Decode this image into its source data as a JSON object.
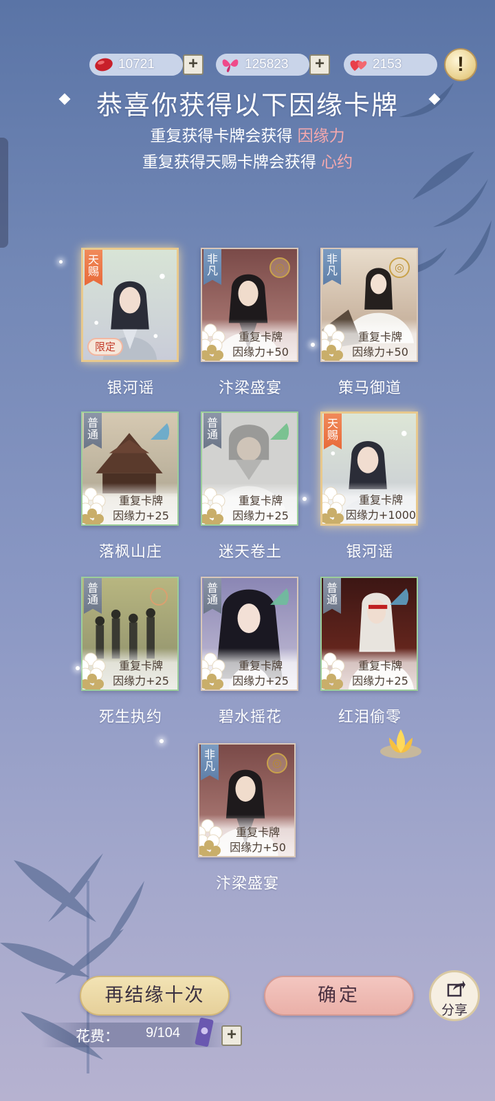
{
  "currency": [
    {
      "icon": "red-bean-icon",
      "value": "10721",
      "has_plus": true
    },
    {
      "icon": "butterfly-icon",
      "value": "125823",
      "has_plus": true
    },
    {
      "icon": "hearts-icon",
      "value": "2153",
      "has_plus": false
    }
  ],
  "alert_label": "!",
  "header": {
    "title": "恭喜你获得以下因缘卡牌",
    "line1_text": "重复获得卡牌会获得",
    "line1_highlight": "因缘力",
    "line2_text": "重复获得天赐卡牌会获得",
    "line2_highlight": "心约"
  },
  "cards": [
    {
      "name": "银河谣",
      "rarity": "天赐",
      "limited": "限定",
      "duplicate": false,
      "dup_line1": "",
      "dup_line2": ""
    },
    {
      "name": "汴梁盛宴",
      "rarity": "非凡",
      "limited": "",
      "duplicate": true,
      "dup_line1": "重复卡牌",
      "dup_line2": "因缘力+50"
    },
    {
      "name": "策马御道",
      "rarity": "非凡",
      "limited": "",
      "duplicate": true,
      "dup_line1": "重复卡牌",
      "dup_line2": "因缘力+50"
    },
    {
      "name": "落枫山庄",
      "rarity": "普通",
      "limited": "",
      "duplicate": true,
      "dup_line1": "重复卡牌",
      "dup_line2": "因缘力+25"
    },
    {
      "name": "迷天卷土",
      "rarity": "普通",
      "limited": "",
      "duplicate": true,
      "dup_line1": "重复卡牌",
      "dup_line2": "因缘力+25"
    },
    {
      "name": "银河谣",
      "rarity": "天赐",
      "limited": "",
      "duplicate": true,
      "dup_line1": "重复卡牌",
      "dup_line2": "因缘力+1000"
    },
    {
      "name": "死生执约",
      "rarity": "普通",
      "limited": "",
      "duplicate": true,
      "dup_line1": "重复卡牌",
      "dup_line2": "因缘力+25"
    },
    {
      "name": "碧水摇花",
      "rarity": "普通",
      "limited": "",
      "duplicate": true,
      "dup_line1": "重复卡牌",
      "dup_line2": "因缘力+25"
    },
    {
      "name": "红泪偷零",
      "rarity": "普通",
      "limited": "",
      "duplicate": true,
      "dup_line1": "重复卡牌",
      "dup_line2": "因缘力+25"
    },
    {
      "name": "汴梁盛宴",
      "rarity": "非凡",
      "limited": "",
      "duplicate": true,
      "dup_line1": "重复卡牌",
      "dup_line2": "因缘力+50"
    }
  ],
  "buttons": {
    "again": "再结缘十次",
    "confirm": "确定",
    "share": "分享"
  },
  "cost": {
    "label": "花费：",
    "value": "9/104",
    "plus": "+"
  },
  "colors": {
    "highlight": "#f4a9ae",
    "rarity_tianci": "#e86a3a",
    "rarity_feifan": "#5f7fa8",
    "rarity_putong": "#6c7688"
  }
}
